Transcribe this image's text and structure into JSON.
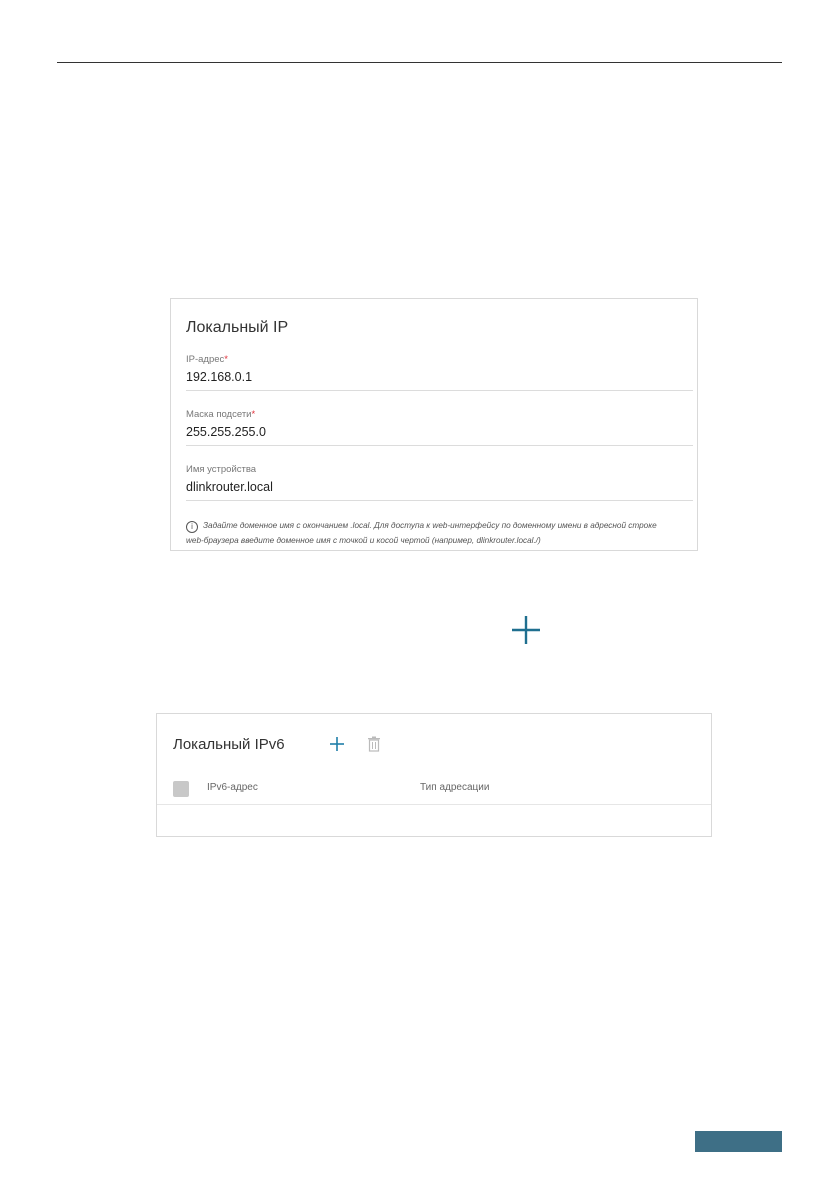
{
  "local_ip": {
    "title": "Локальный IP",
    "fields": [
      {
        "label": "IP-адрес",
        "required": "*",
        "value": "192.168.0.1"
      },
      {
        "label": "Маска подсети",
        "required": "*",
        "value": "255.255.255.0"
      },
      {
        "label": "Имя устройства",
        "required": "",
        "value": "dlinkrouter.local"
      }
    ],
    "hint_icon": "i",
    "hint_line1": "Задайте доменное имя с окончанием .local. Для доступа к web-интерфейсу по доменному имени в адресной строке",
    "hint_line2": "web-браузера введите доменное имя с точкой и косой чертой (например, dlinkrouter.local./)"
  },
  "icons": {
    "add_big": "plus-icon",
    "add": "plus-icon",
    "delete": "trash-icon",
    "info": "info-icon"
  },
  "local_ipv6": {
    "title": "Локальный IPv6",
    "columns": [
      "IPv6-адрес",
      "Тип адресации"
    ]
  },
  "colors": {
    "accent": "#1f7fa8",
    "required": "#e0303a",
    "page_box": "#3e6f86"
  }
}
